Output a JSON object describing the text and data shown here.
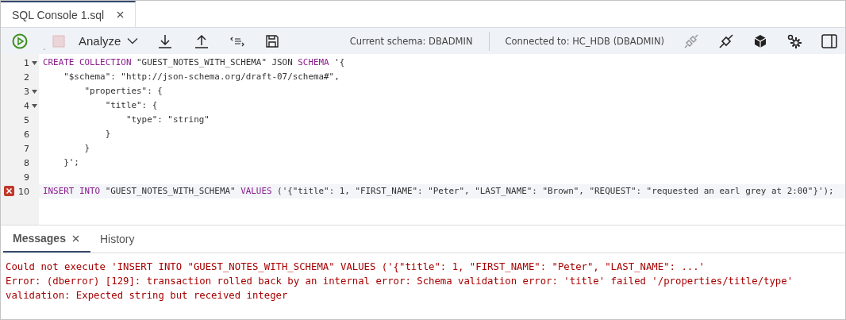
{
  "tabs": [
    {
      "label": "SQL Console 1.sql",
      "selected": true,
      "closable": true
    }
  ],
  "toolbar": {
    "left": [
      {
        "kind": "run",
        "disabled": false
      },
      {
        "kind": "stop",
        "disabled": true
      },
      {
        "kind": "menu",
        "label": "Analyze",
        "disabled": false
      },
      {
        "kind": "download",
        "disabled": false
      },
      {
        "kind": "upload",
        "disabled": false
      },
      {
        "kind": "format",
        "disabled": false
      },
      {
        "kind": "save",
        "disabled": false
      }
    ],
    "current_schema": "Current schema: DBADMIN",
    "connection": "Connected to: HC_HDB (DBADMIN)",
    "right": [
      {
        "kind": "disconnect",
        "disabled": true
      },
      {
        "kind": "connect",
        "disabled": false
      },
      {
        "kind": "cube",
        "disabled": false
      },
      {
        "kind": "gears",
        "disabled": false
      },
      {
        "kind": "panel",
        "disabled": false
      }
    ]
  },
  "editor": {
    "lines": [
      {
        "number": "1",
        "foldable": true,
        "error": false,
        "active": false,
        "tokens": [
          {
            "kind": "keyword",
            "text": "CREATE COLLECTION"
          },
          {
            "kind": "plain",
            "text": " \"GUEST_NOTES_WITH_SCHEMA\" JSON "
          },
          {
            "kind": "keyword",
            "text": "SCHEMA"
          },
          {
            "kind": "plain",
            "text": " '{"
          }
        ]
      },
      {
        "number": "2",
        "foldable": false,
        "error": false,
        "active": false,
        "tokens": [
          {
            "kind": "plain",
            "text": "    \"$schema\": \"http://json-schema.org/draft-07/schema#\","
          }
        ]
      },
      {
        "number": "3",
        "foldable": true,
        "error": false,
        "active": false,
        "tokens": [
          {
            "kind": "plain",
            "text": "        \"properties\": {"
          }
        ]
      },
      {
        "number": "4",
        "foldable": true,
        "error": false,
        "active": false,
        "tokens": [
          {
            "kind": "plain",
            "text": "            \"title\": {"
          }
        ]
      },
      {
        "number": "5",
        "foldable": false,
        "error": false,
        "active": false,
        "tokens": [
          {
            "kind": "plain",
            "text": "                \"type\": \"string\""
          }
        ]
      },
      {
        "number": "6",
        "foldable": false,
        "error": false,
        "active": false,
        "tokens": [
          {
            "kind": "plain",
            "text": "            }"
          }
        ]
      },
      {
        "number": "7",
        "foldable": false,
        "error": false,
        "active": false,
        "tokens": [
          {
            "kind": "plain",
            "text": "        }"
          }
        ]
      },
      {
        "number": "8",
        "foldable": false,
        "error": false,
        "active": false,
        "tokens": [
          {
            "kind": "plain",
            "text": "    }';"
          }
        ]
      },
      {
        "number": "9",
        "foldable": false,
        "error": false
      },
      {
        "number": "10",
        "foldable": false,
        "error": true,
        "active": true,
        "tokens": [
          {
            "kind": "keyword",
            "text": "INSERT INTO"
          },
          {
            "kind": "plain",
            "text": " \"GUEST_NOTES_WITH_SCHEMA\" "
          },
          {
            "kind": "keyword",
            "text": "VALUES"
          },
          {
            "kind": "plain",
            "text": " ('{\"title\": 1, \"FIRST_NAME\": \"Peter\", \"LAST_NAME\": \"Brown\", \"REQUEST\": \"requested an earl grey at 2:00\"}');"
          }
        ]
      }
    ]
  },
  "bottom_panel": {
    "tabs": [
      {
        "label": "Messages",
        "selected": true,
        "closable": true
      },
      {
        "label": "History",
        "selected": false,
        "closable": false
      }
    ],
    "messages": [
      "Could not execute 'INSERT INTO \"GUEST_NOTES_WITH_SCHEMA\" VALUES ('{\"title\": 1, \"FIRST_NAME\": \"Peter\", \"LAST_NAME\": ...'",
      "Error: (dberror) [129]: transaction rolled back by an internal error: Schema validation error: 'title' failed '/properties/title/type' validation: Expected string but received integer"
    ]
  }
}
